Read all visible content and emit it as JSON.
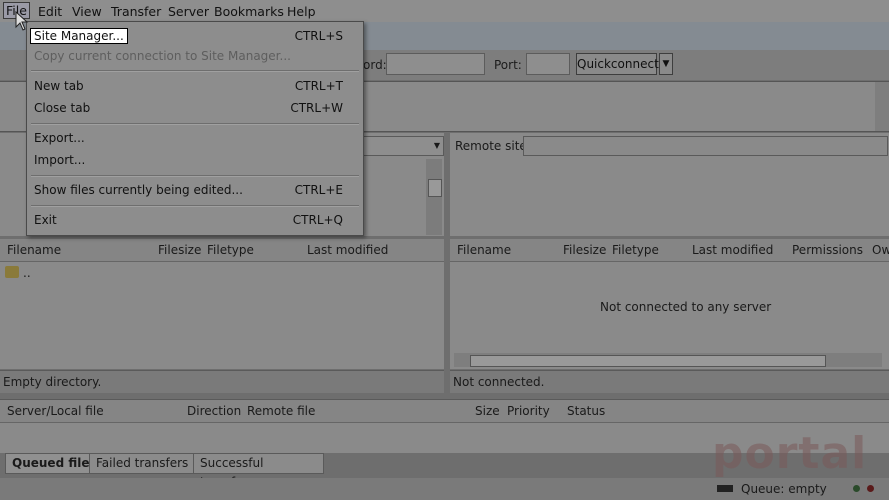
{
  "menubar": {
    "items": [
      "File",
      "Edit",
      "View",
      "Transfer",
      "Server",
      "Bookmarks",
      "Help"
    ]
  },
  "file_menu": {
    "items": [
      {
        "label": "Site Manager...",
        "shortcut": "CTRL+S"
      },
      {
        "label": "Copy current connection to Site Manager...",
        "shortcut": ""
      },
      {
        "label": "New tab",
        "shortcut": "CTRL+T"
      },
      {
        "label": "Close tab",
        "shortcut": "CTRL+W"
      },
      {
        "label": "Export...",
        "shortcut": ""
      },
      {
        "label": "Import...",
        "shortcut": ""
      },
      {
        "label": "Show files currently being edited...",
        "shortcut": "CTRL+E"
      },
      {
        "label": "Exit",
        "shortcut": "CTRL+Q"
      }
    ]
  },
  "quickconnect": {
    "password_label": "ord:",
    "port_label": "Port:",
    "button_label": "Quickconnect",
    "dropdown_icon": "▼"
  },
  "remote_site": {
    "label": "Remote site:"
  },
  "local_list": {
    "columns": [
      "Filename",
      "Filesize",
      "Filetype",
      "Last modified"
    ],
    "rows": [
      ".."
    ],
    "status": "Empty directory."
  },
  "remote_list": {
    "columns": [
      "Filename",
      "Filesize",
      "Filetype",
      "Last modified",
      "Permissions",
      "Ow"
    ],
    "message": "Not connected to any server",
    "status": "Not connected."
  },
  "queue": {
    "columns": [
      "Server/Local file",
      "Direction",
      "Remote file",
      "Size",
      "Priority",
      "Status"
    ],
    "tabs": [
      "Queued files",
      "Failed transfers",
      "Successful transfers"
    ],
    "status": "Queue: empty"
  },
  "watermark": {
    "text": "portal"
  },
  "colors": {
    "highlight_bg": "#ffffff",
    "overlay": "#6e6e6e"
  }
}
